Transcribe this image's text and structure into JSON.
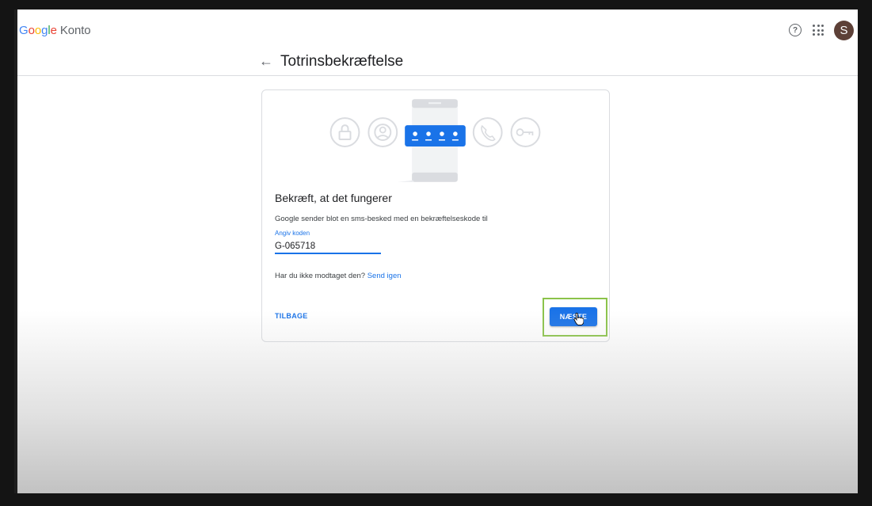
{
  "header": {
    "logo_letters": [
      "G",
      "o",
      "o",
      "g",
      "l",
      "e"
    ],
    "product": "Konto",
    "avatar_letter": "S"
  },
  "page": {
    "title": "Totrinsbekræftelse"
  },
  "card": {
    "heading": "Bekræft, at det fungerer",
    "description": "Google sender blot en sms-besked med en bekræftelseskode til",
    "code_label": "Angiv koden",
    "code_value": "G-065718",
    "resend_prompt": "Har du ikke modtaget den?",
    "resend_link": "Send igen",
    "back_label": "TILBAGE",
    "next_label": "NÆSTE"
  },
  "colors": {
    "accent": "#1a73e8",
    "avatar_bg": "#5d4037",
    "highlight": "#8bc34a"
  },
  "icons": [
    "help-icon",
    "apps-grid-icon",
    "back-arrow-icon",
    "lock-icon",
    "person-icon",
    "phone-icon",
    "key-icon",
    "password-dots-icon",
    "hand-cursor-icon"
  ]
}
